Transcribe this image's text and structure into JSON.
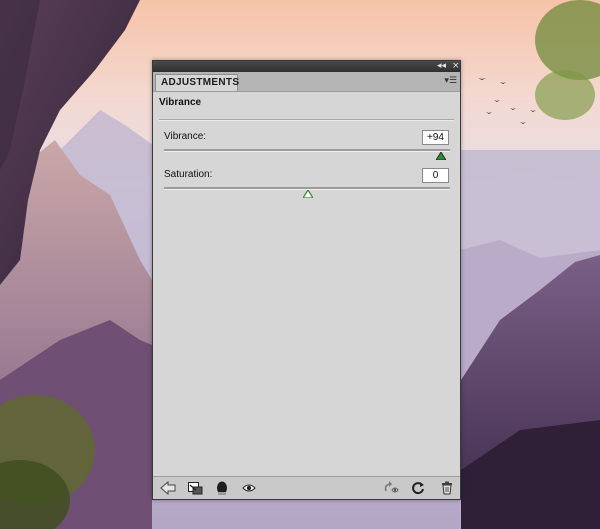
{
  "panel": {
    "tab_label": "ADJUSTMENTS",
    "collapse_glyph": "◂◂",
    "close_glyph": "×",
    "menu_glyph": "▾☰",
    "heading": "Vibrance"
  },
  "sliders": [
    {
      "label": "Vibrance:",
      "value": "+94",
      "level": 0.97
    },
    {
      "label": "Saturation:",
      "value": "0",
      "level": 0.5
    }
  ],
  "footer_icons": [
    "back-arrow-icon",
    "clip-to-layer-icon",
    "layer-visibility-mask-icon",
    "eye-icon",
    "previous-state-icon",
    "reset-icon",
    "trash-icon"
  ],
  "colors": {
    "panel_bg": "#d6d6d6",
    "titlebar": "#2f2f2f",
    "slider_thumb": "#2e8b2e"
  }
}
